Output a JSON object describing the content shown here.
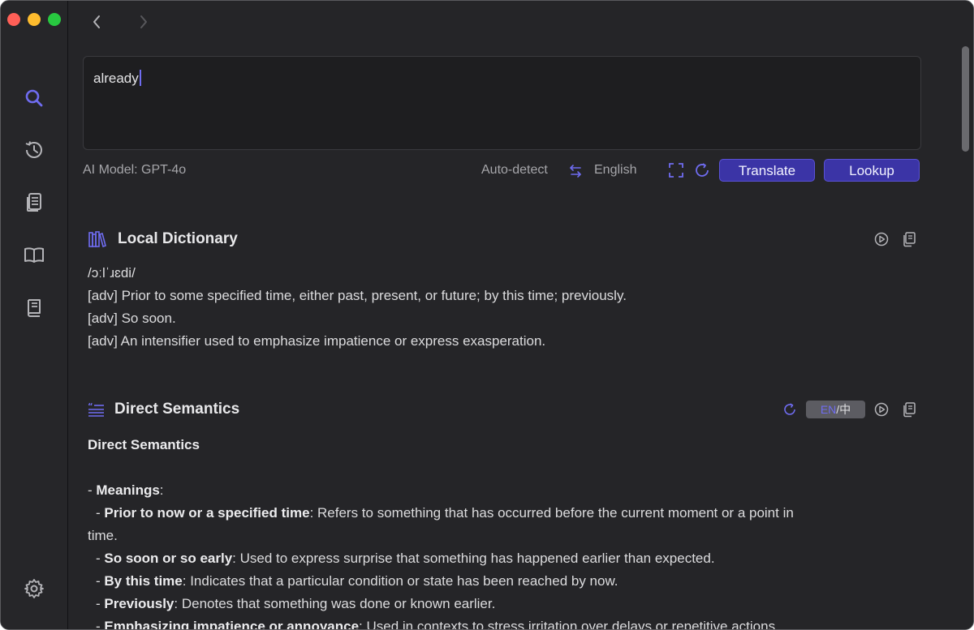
{
  "window": {
    "controls": [
      "close",
      "minimize",
      "zoom"
    ]
  },
  "sidebar": {
    "items": [
      {
        "name": "search",
        "icon": "search-icon",
        "active": true
      },
      {
        "name": "history",
        "icon": "history-icon"
      },
      {
        "name": "notes",
        "icon": "notes-icon"
      },
      {
        "name": "dictionary",
        "icon": "book-open-icon"
      },
      {
        "name": "wordbook",
        "icon": "book-icon"
      }
    ],
    "settings_icon": "gear-icon"
  },
  "input": {
    "value": "already"
  },
  "toolbar": {
    "ai_model": "AI Model: GPT-4o",
    "source_lang": "Auto-detect",
    "target_lang": "English",
    "translate_label": "Translate",
    "lookup_label": "Lookup"
  },
  "local_dictionary": {
    "title": "Local Dictionary",
    "phonetic": "/ɔːlˈɹɛdi/",
    "definitions": [
      "[adv] Prior to some specified time, either past, present, or future; by this time; previously.",
      "[adv] So soon.",
      "[adv] An intensifier used to emphasize impatience or express exasperation."
    ]
  },
  "direct_semantics": {
    "title": "Direct Semantics",
    "toggle_en": "EN",
    "toggle_sep": "/",
    "toggle_zh": "中",
    "heading": "Direct Semantics",
    "meanings_prefix": "- ",
    "meanings_label": "Meanings",
    "meanings_colon": ":",
    "items": [
      {
        "term": "Prior to now or a specified time",
        "desc": ": Refers to something that has occurred before the current moment or a point in"
      },
      {
        "term": "",
        "desc": "time."
      },
      {
        "term": "So soon or so early",
        "desc": ": Used to express surprise that something has happened earlier than expected."
      },
      {
        "term": "By this time",
        "desc": ": Indicates that a particular condition or state has been reached by now."
      },
      {
        "term": "Previously",
        "desc": ": Denotes that something was done or known earlier."
      },
      {
        "term": "Emphasizing impatience or annoyance",
        "desc": ": Used in contexts to stress irritation over delays or repetitive actions."
      }
    ],
    "item_prefix": "- "
  },
  "colors": {
    "accent": "#6f6cf0",
    "button": "#3b34a6",
    "background": "#252528"
  }
}
